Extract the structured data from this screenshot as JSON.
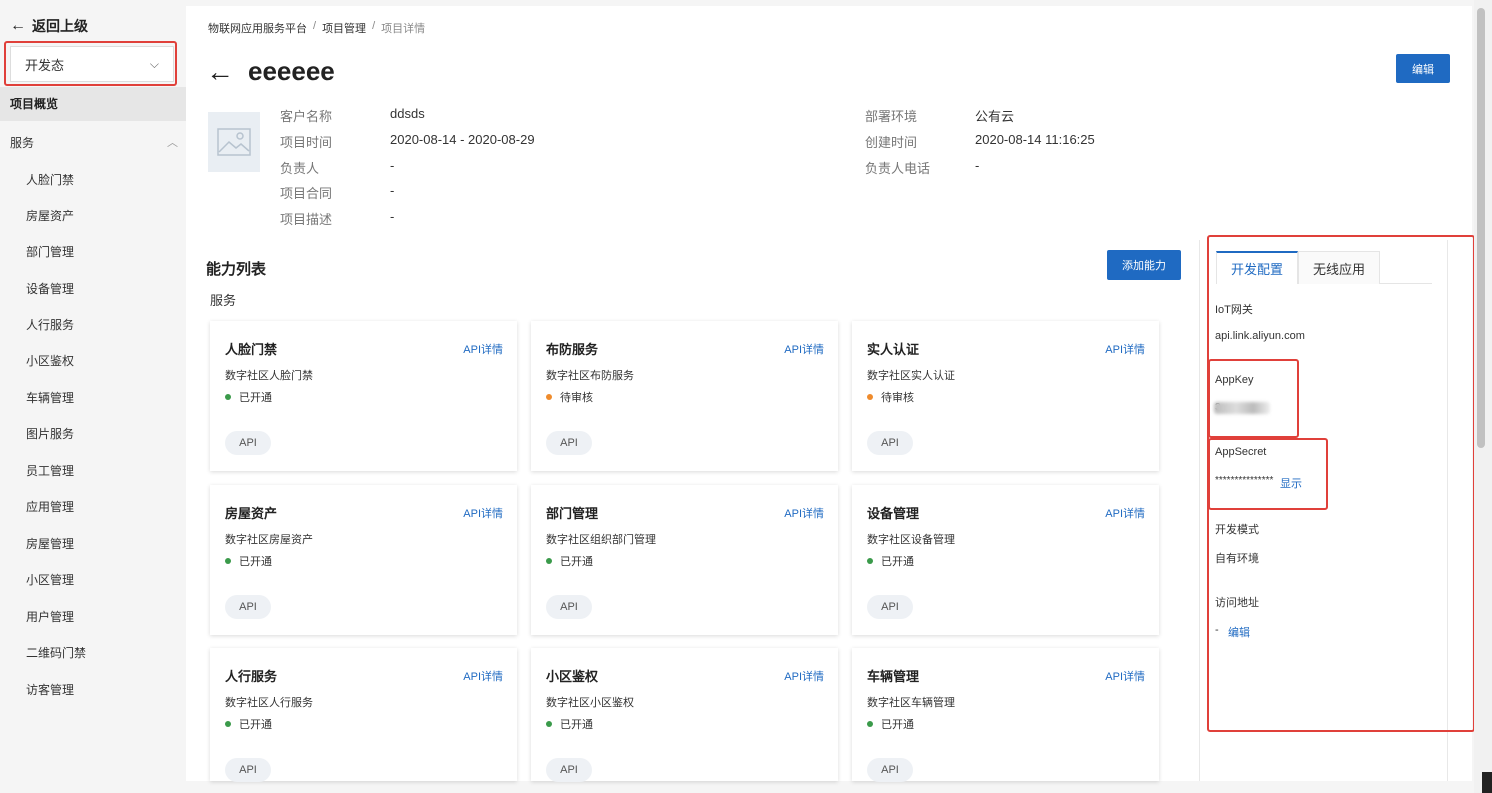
{
  "sidebar": {
    "back_label": "返回上级",
    "env_select": "开发态",
    "overview": "项目概览",
    "group_label": "服务",
    "items": [
      "人脸门禁",
      "房屋资产",
      "部门管理",
      "设备管理",
      "人行服务",
      "小区鉴权",
      "车辆管理",
      "图片服务",
      "员工管理",
      "应用管理",
      "房屋管理",
      "小区管理",
      "用户管理",
      "二维码门禁",
      "访客管理"
    ]
  },
  "breadcrumb": [
    "物联网应用服务平台",
    "项目管理",
    "项目详情"
  ],
  "page": {
    "title": "eeeeee",
    "edit_button": "编辑"
  },
  "info": {
    "customer_label": "客户名称",
    "customer_value": "ddsds",
    "time_label": "项目时间",
    "time_value": "2020-08-14 - 2020-08-29",
    "owner_label": "负责人",
    "owner_value": "-",
    "contract_label": "项目合同",
    "contract_value": "-",
    "desc_label": "项目描述",
    "desc_value": "-",
    "deploy_label": "部署环境",
    "deploy_value": "公有云",
    "created_label": "创建时间",
    "created_value": "2020-08-14 11:16:25",
    "phone_label": "负责人电话",
    "phone_value": "-"
  },
  "capabilities": {
    "title": "能力列表",
    "add_button": "添加能力",
    "subtitle": "服务",
    "cards": [
      {
        "title": "人脸门禁",
        "link": "API详情",
        "desc": "数字社区人脸门禁",
        "status": "已开通",
        "status_color": "#3a9a4a",
        "tag": "API"
      },
      {
        "title": "布防服务",
        "link": "API详情",
        "desc": "数字社区布防服务",
        "status": "待审核",
        "status_color": "#ef8b2c",
        "tag": "API"
      },
      {
        "title": "实人认证",
        "link": "API详情",
        "desc": "数字社区实人认证",
        "status": "待审核",
        "status_color": "#ef8b2c",
        "tag": "API"
      },
      {
        "title": "房屋资产",
        "link": "API详情",
        "desc": "数字社区房屋资产",
        "status": "已开通",
        "status_color": "#3a9a4a",
        "tag": "API"
      },
      {
        "title": "部门管理",
        "link": "API详情",
        "desc": "数字社区组织部门管理",
        "status": "已开通",
        "status_color": "#3a9a4a",
        "tag": "API"
      },
      {
        "title": "设备管理",
        "link": "API详情",
        "desc": "数字社区设备管理",
        "status": "已开通",
        "status_color": "#3a9a4a",
        "tag": "API"
      },
      {
        "title": "人行服务",
        "link": "API详情",
        "desc": "数字社区人行服务",
        "status": "已开通",
        "status_color": "#3a9a4a",
        "tag": "API"
      },
      {
        "title": "小区鉴权",
        "link": "API详情",
        "desc": "数字社区小区鉴权",
        "status": "已开通",
        "status_color": "#3a9a4a",
        "tag": "API"
      },
      {
        "title": "车辆管理",
        "link": "API详情",
        "desc": "数字社区车辆管理",
        "status": "已开通",
        "status_color": "#3a9a4a",
        "tag": "API"
      }
    ]
  },
  "panel": {
    "tab_dev": "开发配置",
    "tab_wireless": "无线应用",
    "gateway_label": "IoT网关",
    "gateway_value": "api.link.aliyun.com",
    "appkey_label": "AppKey",
    "appkey_value": "3",
    "appsecret_label": "AppSecret",
    "appsecret_value": "***************",
    "show_link": "显示",
    "mode_label": "开发模式",
    "mode_value": "自有环境",
    "access_label": "访问地址",
    "access_value": "-",
    "access_edit": "编辑"
  }
}
